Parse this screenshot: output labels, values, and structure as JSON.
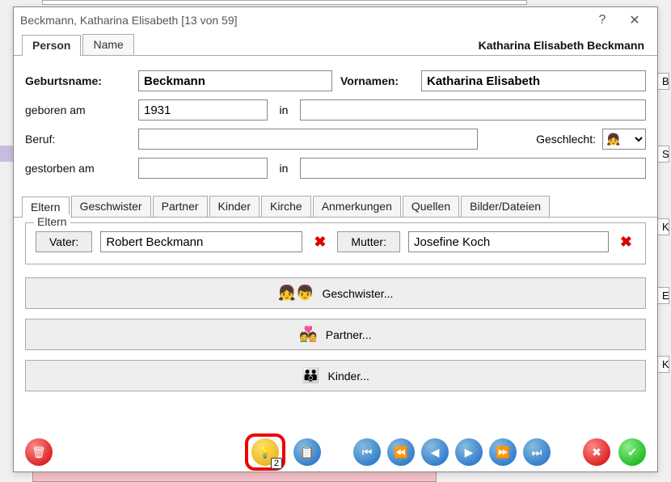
{
  "window": {
    "title": "Beckmann, Katharina Elisabeth [13 von 59]",
    "help": "?",
    "close": "✕"
  },
  "tabs_top": {
    "person": "Person",
    "name": "Name"
  },
  "person_fullname": "Katharina Elisabeth Beckmann",
  "labels": {
    "geburtsname": "Geburtsname:",
    "vornamen": "Vornamen:",
    "geboren_am": "geboren am",
    "in": "in",
    "beruf": "Beruf:",
    "geschlecht": "Geschlecht:",
    "gestorben_am": "gestorben am"
  },
  "fields": {
    "geburtsname": "Beckmann",
    "vornamen": "Katharina Elisabeth",
    "geboren_am": "1931",
    "geboren_in": "",
    "beruf": "",
    "gestorben_am": "",
    "gestorben_in": "",
    "geschlecht_icon": "👧"
  },
  "tabs_mid": {
    "eltern": "Eltern",
    "geschwister": "Geschwister",
    "partner": "Partner",
    "kinder": "Kinder",
    "kirche": "Kirche",
    "anmerkungen": "Anmerkungen",
    "quellen": "Quellen",
    "bilder": "Bilder/Dateien"
  },
  "eltern": {
    "legend": "Eltern",
    "vater_label": "Vater:",
    "vater": "Robert Beckmann",
    "mutter_label": "Mutter:",
    "mutter": "Josefine Koch"
  },
  "bigbuttons": {
    "geschwister": "Geschwister...",
    "partner": "Partner...",
    "kinder": "Kinder..."
  },
  "bottom": {
    "tips_count": "2"
  },
  "bg": {
    "h2": "B",
    "h3": "S",
    "h4": "K",
    "h5": "E",
    "h6": "K"
  }
}
